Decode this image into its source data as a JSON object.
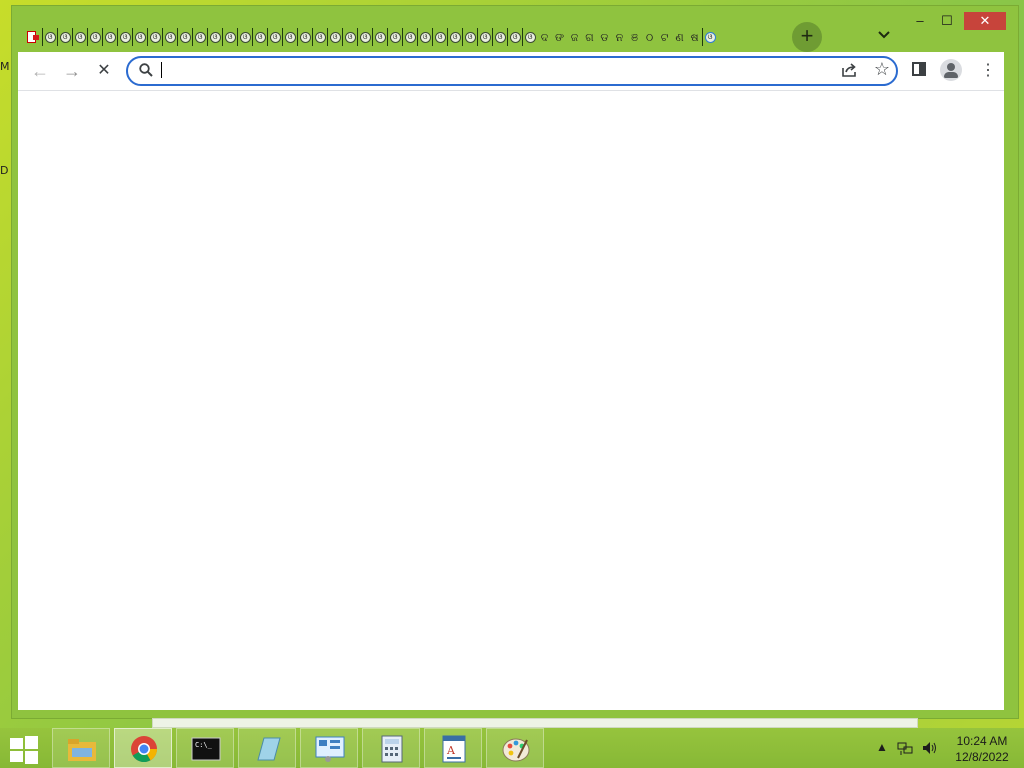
{
  "desktop": {
    "glyph_top": "M",
    "glyph_mid": "D"
  },
  "browser": {
    "tabs": {
      "first_icon": "pdf-icon",
      "ring_tabs": 33,
      "slim_glyphs": [
        "ଦ",
        "ଙ",
        "ଜ",
        "ଗ",
        "ଡ",
        "ନ",
        "ଞ",
        "ଠ",
        "ଟ",
        "ଣ",
        "ଷ"
      ],
      "active_index": 35
    },
    "new_tab_label": "+",
    "tab_search_label": "⌄",
    "window_controls": {
      "minimize": "–",
      "maximize": "☐",
      "close": "✕"
    },
    "toolbar": {
      "back": "←",
      "forward": "→",
      "stop": "✕",
      "omnibox": {
        "value": "",
        "placeholder": ""
      },
      "bookmark": "☆",
      "menu": "⋮"
    }
  },
  "taskbar": {
    "apps": [
      {
        "name": "file-explorer",
        "active": false
      },
      {
        "name": "chrome",
        "active": true
      },
      {
        "name": "command-prompt",
        "active": false
      },
      {
        "name": "notepad",
        "active": false
      },
      {
        "name": "control-panel",
        "active": false
      },
      {
        "name": "calculator",
        "active": false
      },
      {
        "name": "wordpad",
        "active": false
      },
      {
        "name": "paint",
        "active": false
      }
    ],
    "tray": {
      "expand": "▲"
    },
    "clock": {
      "time": "10:24 AM",
      "date": "12/8/2022"
    }
  }
}
